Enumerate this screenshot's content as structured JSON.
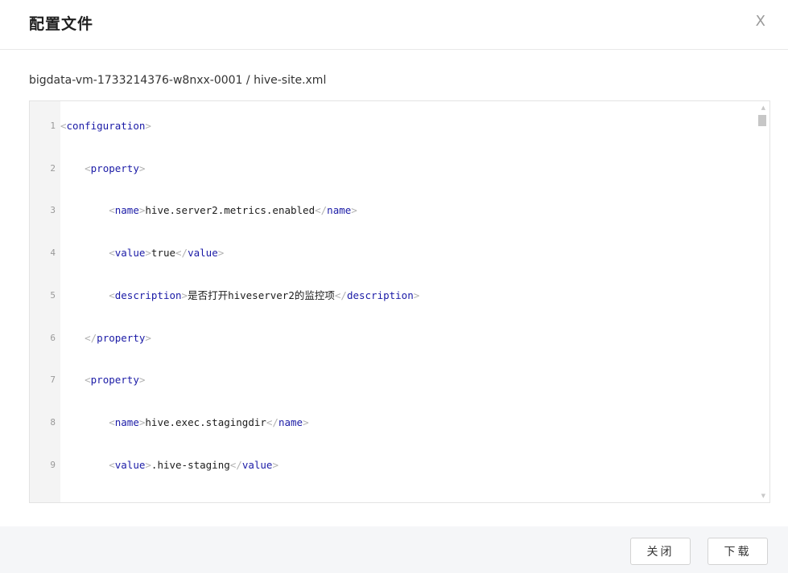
{
  "dialog": {
    "title": "配置文件",
    "close_icon": "X"
  },
  "file_path": "bigdata-vm-1733214376-w8nxx-0001 / hive-site.xml",
  "editor": {
    "lines": [
      {
        "num": "1",
        "indent": "",
        "parts": [
          [
            "br",
            "<"
          ],
          [
            "tag",
            "configuration"
          ],
          [
            "br",
            ">"
          ]
        ]
      },
      {
        "num": "2",
        "indent": "    ",
        "parts": [
          [
            "br",
            "<"
          ],
          [
            "tag",
            "property"
          ],
          [
            "br",
            ">"
          ]
        ]
      },
      {
        "num": "3",
        "indent": "        ",
        "parts": [
          [
            "br",
            "<"
          ],
          [
            "tag",
            "name"
          ],
          [
            "br",
            ">"
          ],
          [
            "txt",
            "hive.server2.metrics.enabled"
          ],
          [
            "br",
            "</"
          ],
          [
            "tag",
            "name"
          ],
          [
            "br",
            ">"
          ]
        ]
      },
      {
        "num": "4",
        "indent": "        ",
        "parts": [
          [
            "br",
            "<"
          ],
          [
            "tag",
            "value"
          ],
          [
            "br",
            ">"
          ],
          [
            "txt",
            "true"
          ],
          [
            "br",
            "</"
          ],
          [
            "tag",
            "value"
          ],
          [
            "br",
            ">"
          ]
        ]
      },
      {
        "num": "5",
        "indent": "        ",
        "parts": [
          [
            "br",
            "<"
          ],
          [
            "tag",
            "description"
          ],
          [
            "br",
            ">"
          ],
          [
            "txt",
            "是否打开hiveserver2的监控项"
          ],
          [
            "br",
            "</"
          ],
          [
            "tag",
            "description"
          ],
          [
            "br",
            ">"
          ]
        ]
      },
      {
        "num": "6",
        "indent": "    ",
        "parts": [
          [
            "br",
            "</"
          ],
          [
            "tag",
            "property"
          ],
          [
            "br",
            ">"
          ]
        ]
      },
      {
        "num": "7",
        "indent": "    ",
        "parts": [
          [
            "br",
            "<"
          ],
          [
            "tag",
            "property"
          ],
          [
            "br",
            ">"
          ]
        ]
      },
      {
        "num": "8",
        "indent": "        ",
        "parts": [
          [
            "br",
            "<"
          ],
          [
            "tag",
            "name"
          ],
          [
            "br",
            ">"
          ],
          [
            "txt",
            "hive.exec.stagingdir"
          ],
          [
            "br",
            "</"
          ],
          [
            "tag",
            "name"
          ],
          [
            "br",
            ">"
          ]
        ]
      },
      {
        "num": "9",
        "indent": "        ",
        "parts": [
          [
            "br",
            "<"
          ],
          [
            "tag",
            "value"
          ],
          [
            "br",
            ">"
          ],
          [
            "txt",
            ".hive-staging"
          ],
          [
            "br",
            "</"
          ],
          [
            "tag",
            "value"
          ],
          [
            "br",
            ">"
          ]
        ]
      }
    ]
  },
  "footer": {
    "close_label": "关闭",
    "download_label": "下载"
  },
  "icons": {
    "scroll_up": "▲",
    "scroll_down": "▼"
  }
}
